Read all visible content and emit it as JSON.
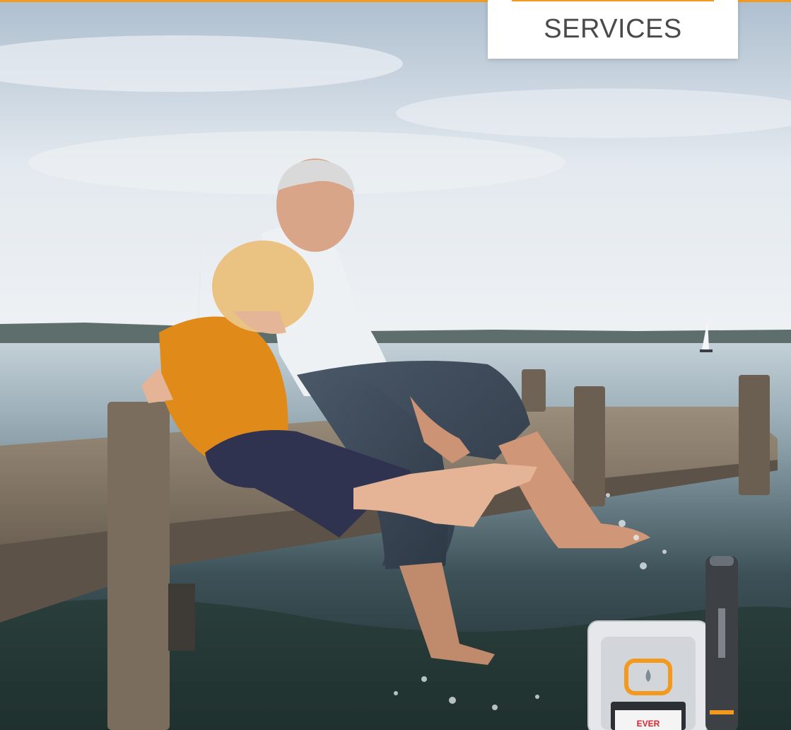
{
  "nav": {
    "services_label": "SERVICES"
  },
  "colors": {
    "accent": "#f39a1e",
    "sky_top": "#b9c9d8",
    "water": "#2a3a3f",
    "shirt_child": "#e08a1a"
  },
  "device": {
    "brand_text": "EVER"
  },
  "hero": {
    "icon": "water-drop-icon"
  }
}
